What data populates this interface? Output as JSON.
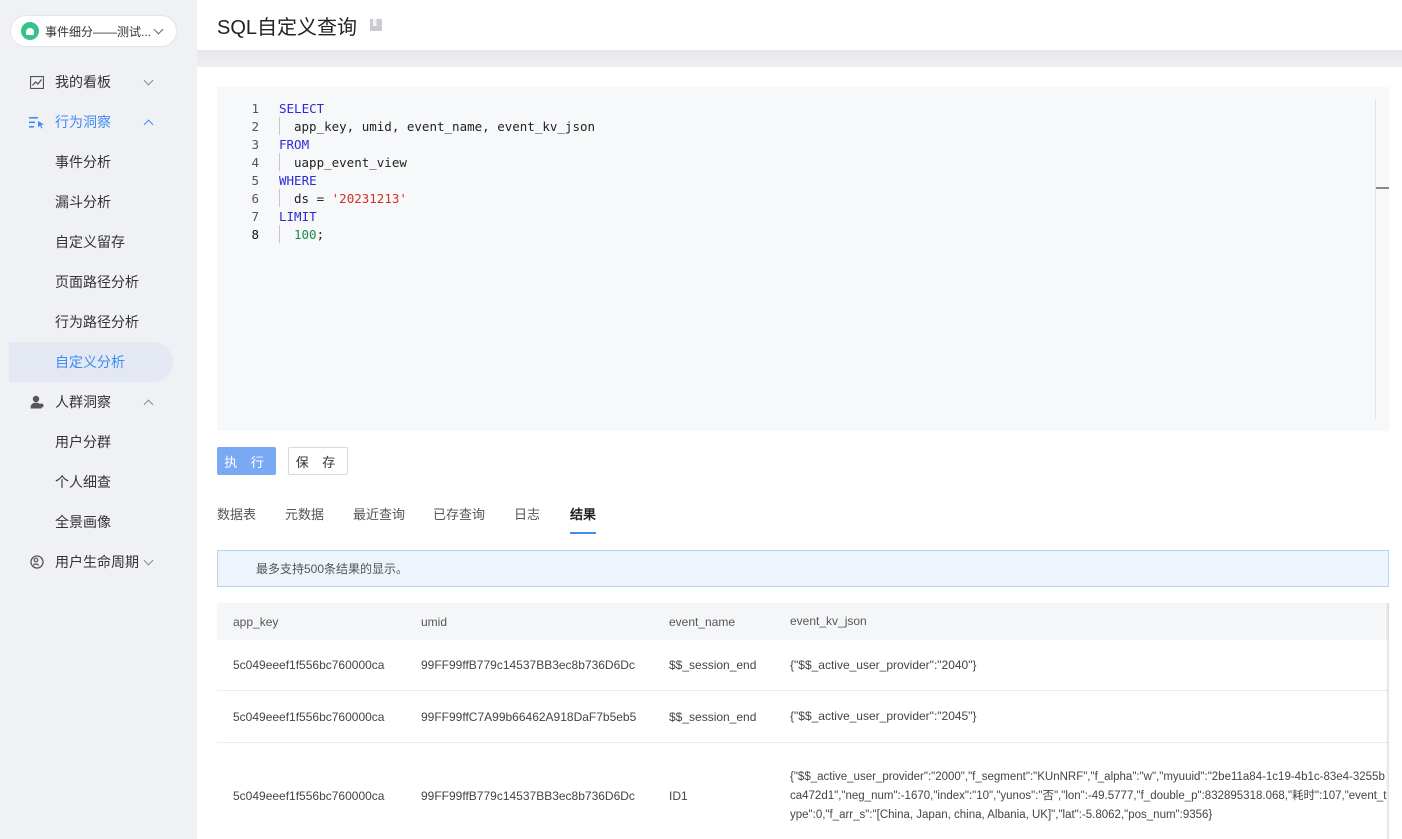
{
  "app_selector": {
    "name": "事件细分——测试..."
  },
  "sidebar": {
    "groups": [
      {
        "label": "我的看板"
      },
      {
        "label": "行为洞察",
        "items": [
          "事件分析",
          "漏斗分析",
          "自定义留存",
          "页面路径分析",
          "行为路径分析",
          "自定义分析"
        ]
      },
      {
        "label": "人群洞察",
        "items": [
          "用户分群",
          "个人细查",
          "全景画像"
        ]
      },
      {
        "label": "用户生命周期"
      }
    ]
  },
  "header": {
    "title": "SQL自定义查询"
  },
  "editor": {
    "line_numbers": [
      "1",
      "2",
      "3",
      "4",
      "5",
      "6",
      "7",
      "8"
    ],
    "lines": {
      "l1": "SELECT",
      "l2": "app_key, umid, event_name, event_kv_json",
      "l3": "FROM",
      "l4": "uapp_event_view",
      "l5": "WHERE",
      "l6_a": "ds = ",
      "l6_b": "'20231213'",
      "l7": "LIMIT",
      "l8_a": "100",
      "l8_b": ";"
    }
  },
  "buttons": {
    "run": "执 行",
    "save": "保 存"
  },
  "tabs": [
    "数据表",
    "元数据",
    "最近查询",
    "已存查询",
    "日志",
    "结果"
  ],
  "active_tab": "结果",
  "notice": "最多支持500条结果的显示。",
  "table": {
    "columns": [
      "app_key",
      "umid",
      "event_name",
      "event_kv_json"
    ],
    "rows": [
      [
        "5c049eeef1f556bc760000ca",
        "99FF99ffB779c14537BB3ec8b736D6Dc",
        "$$_session_end",
        "{\"$$_active_user_provider\":\"2040\"}"
      ],
      [
        "5c049eeef1f556bc760000ca",
        "99FF99ffC7A99b66462A918DaF7b5eb5",
        "$$_session_end",
        "{\"$$_active_user_provider\":\"2045\"}"
      ],
      [
        "5c049eeef1f556bc760000ca",
        "99FF99ffB779c14537BB3ec8b736D6Dc",
        "ID1",
        "{\"$$_active_user_provider\":\"2000\",\"f_segment\":\"KUnNRF\",\"f_alpha\":\"w\",\"myuuid\":\"2be11a84-1c19-4b1c-83e4-3255bca472d1\",\"neg_num\":-1670,\"index\":\"10\",\"yunos\":\"否\",\"lon\":-49.5777,\"f_double_p\":832895318.068,\"耗时\":107,\"event_type\":0,\"f_arr_s\":\"[China, Japan, china, Albania, UK]\",\"lat\":-5.8062,\"pos_num\":9356}"
      ]
    ]
  },
  "colors": {
    "accent": "#3f8cf3",
    "run_button": "#7aa9f3",
    "sidebar_bg": "#f0f1f4",
    "android_green": "#37c28a"
  }
}
